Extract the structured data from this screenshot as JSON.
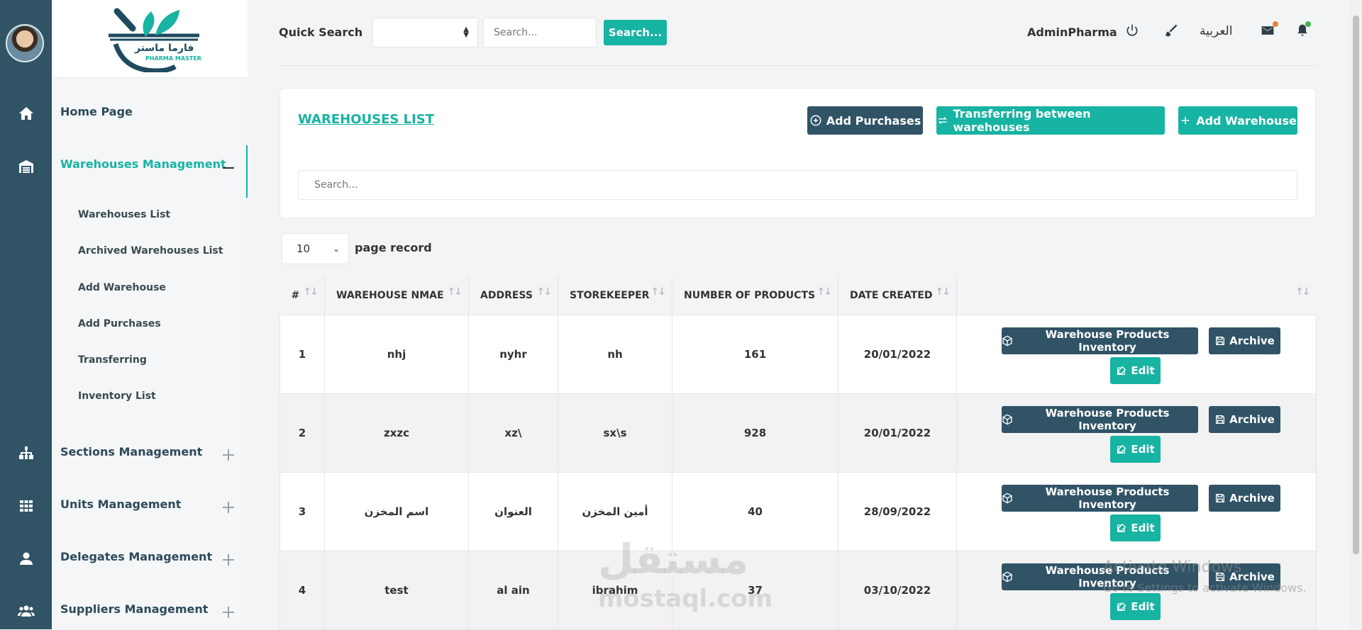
{
  "logo": {
    "arabic": "فارما ماستر",
    "english": "PHARMA MASTER"
  },
  "sidebar": {
    "rail_icons": [
      "home-icon",
      "warehouse-icon",
      "sitemap-icon",
      "grid-icon",
      "user-icon",
      "users-icon"
    ],
    "items": [
      {
        "label": "Home Page"
      },
      {
        "label": "Warehouses Management"
      },
      {
        "label": "Sections Management"
      },
      {
        "label": "Units Management"
      },
      {
        "label": "Delegates Management"
      },
      {
        "label": "Suppliers Management"
      }
    ],
    "sub_items": [
      {
        "label": "Warehouses List"
      },
      {
        "label": "Archived Warehouses List"
      },
      {
        "label": "Add Warehouse"
      },
      {
        "label": "Add Purchases"
      },
      {
        "label": "Transferring"
      },
      {
        "label": "Inventory List"
      }
    ]
  },
  "topbar": {
    "quick_search_label": "Quick Search",
    "search_placeholder": "Search...",
    "search_button": "Search...",
    "user": "AdminPharma",
    "language": "العربية",
    "accent": "#17b3a3",
    "dark": "#305366"
  },
  "card": {
    "title": "WAREHOUSES LIST",
    "add_purchases": "Add Purchases",
    "transfer": "Transferring between warehouses",
    "add_warehouse": "Add Warehouse",
    "search_placeholder": "Search..."
  },
  "pager": {
    "value": "10",
    "label": "page record"
  },
  "table": {
    "headers": [
      "#",
      "WAREHOUSE NMAE",
      "ADDRESS",
      "STOREKEEPER",
      "NUMBER OF PRODUCTS",
      "DATE CREATED"
    ],
    "rows": [
      {
        "num": "1",
        "name": "nhj",
        "address": "nyhr",
        "keeper": "nh",
        "products": "161",
        "date": "20/01/2022"
      },
      {
        "num": "2",
        "name": "zxzc",
        "address": "xz\\",
        "keeper": "sx\\s",
        "products": "928",
        "date": "20/01/2022"
      },
      {
        "num": "3",
        "name": "اسم المخزن",
        "address": "العنوان",
        "keeper": "أمين المخزن",
        "products": "40",
        "date": "28/09/2022"
      },
      {
        "num": "4",
        "name": "test",
        "address": "al ain",
        "keeper": "ibrahim",
        "products": "37",
        "date": "03/10/2022"
      }
    ],
    "actions": {
      "inventory": "Warehouse Products Inventory",
      "archive": "Archive",
      "edit": "Edit"
    }
  },
  "watermark": {
    "brand": "مستقل",
    "url": "mostaql.com"
  },
  "windows_notice": {
    "title": "Activate Windows",
    "subtitle": "Go to Settings to activate Windows."
  }
}
